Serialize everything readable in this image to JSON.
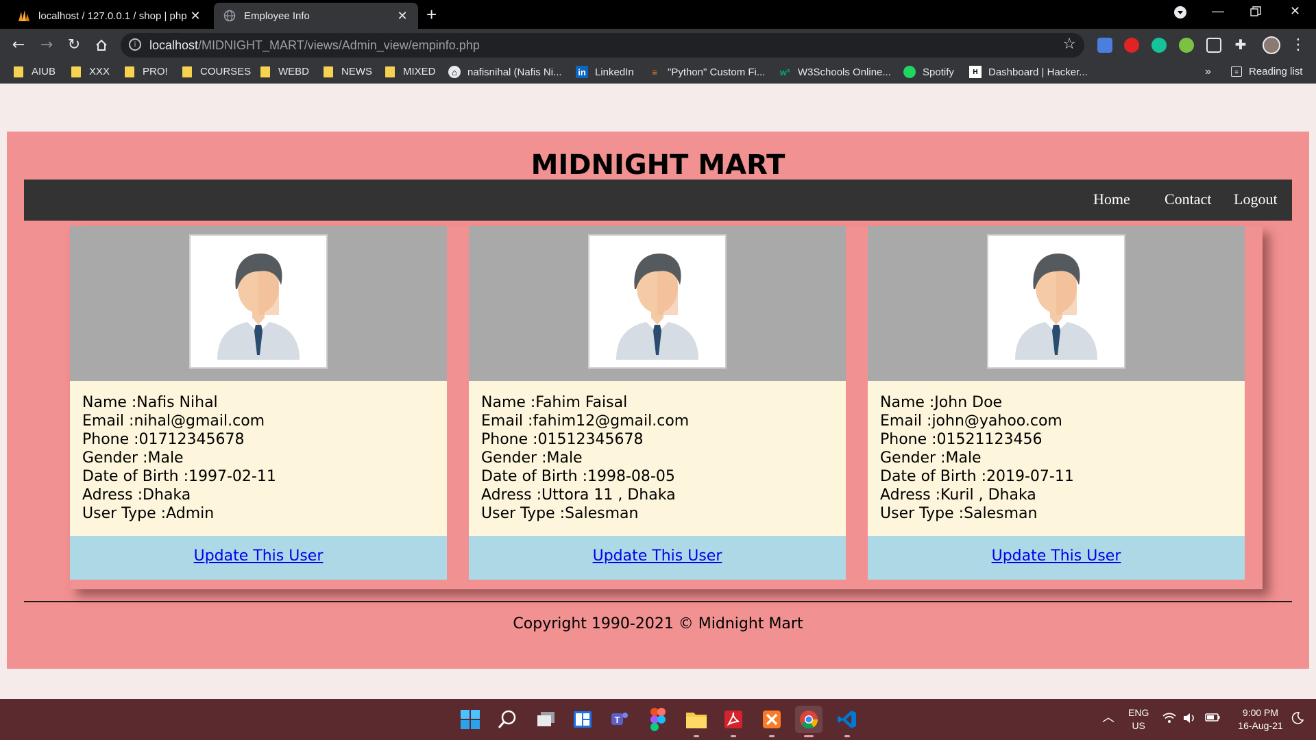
{
  "browser": {
    "tabs": [
      {
        "title": "localhost / 127.0.0.1 / shop | php",
        "icon": "phpmyadmin-icon",
        "active": false
      },
      {
        "title": "Employee Info",
        "icon": "globe-icon",
        "active": true
      }
    ],
    "address_bar": {
      "host": "localhost",
      "path": "/MIDNIGHT_MART/views/Admin_view/empinfo.php"
    },
    "bookmarks": [
      {
        "label": "AIUB",
        "icon": "folder-icon"
      },
      {
        "label": "XXX",
        "icon": "folder-icon"
      },
      {
        "label": "PRO!",
        "icon": "folder-icon"
      },
      {
        "label": "COURSES",
        "icon": "folder-icon"
      },
      {
        "label": "WEBD",
        "icon": "folder-icon"
      },
      {
        "label": "NEWS",
        "icon": "folder-icon"
      },
      {
        "label": "MIXED",
        "icon": "folder-icon"
      },
      {
        "label": "nafisnihal (Nafis Ni...",
        "icon": "github-icon"
      },
      {
        "label": "LinkedIn",
        "icon": "linkedin-icon"
      },
      {
        "label": "\"Python\" Custom Fi...",
        "icon": "stackoverflow-icon"
      },
      {
        "label": "W3Schools Online...",
        "icon": "w3schools-icon"
      },
      {
        "label": "Spotify",
        "icon": "spotify-icon"
      },
      {
        "label": "Dashboard | Hacker...",
        "icon": "hackerrank-icon"
      }
    ],
    "overflow_label": "»",
    "reading_list": "Reading list"
  },
  "site": {
    "title": "MIDNIGHT MART",
    "nav": [
      "Home",
      "Contact",
      "Logout"
    ],
    "employees": [
      {
        "name": "Name :Nafis Nihal",
        "email": "Email :nihal@gmail.com",
        "phone": "Phone :01712345678",
        "gender": "Gender :Male",
        "dob": "Date of Birth :1997-02-11",
        "address": "Adress :Dhaka",
        "user_type": "User Type :Admin",
        "action": "Update This User"
      },
      {
        "name": "Name :Fahim Faisal",
        "email": "Email :fahim12@gmail.com",
        "phone": "Phone :01512345678",
        "gender": "Gender :Male",
        "dob": "Date of Birth :1998-08-05",
        "address": "Adress :Uttora 11 , Dhaka",
        "user_type": "User Type :Salesman",
        "action": "Update This User"
      },
      {
        "name": "Name :John Doe",
        "email": "Email :john@yahoo.com",
        "phone": "Phone :01521123456",
        "gender": "Gender :Male",
        "dob": "Date of Birth :2019-07-11",
        "address": "Adress :Kuril , Dhaka",
        "user_type": "User Type :Salesman",
        "action": "Update This User"
      }
    ],
    "copyright": "Copyright 1990-2021 © Midnight Mart"
  },
  "taskbar": {
    "apps": [
      "windows-start-icon",
      "search-icon",
      "task-view-icon",
      "widgets-icon",
      "teams-icon",
      "figma-icon",
      "file-explorer-icon",
      "acrobat-icon",
      "xampp-icon",
      "chrome-icon",
      "vscode-icon"
    ],
    "language": {
      "line1": "ENG",
      "line2": "US"
    },
    "time": "9:00 PM",
    "date": "16-Aug-21"
  },
  "colors": {
    "page_bg": "#f29191",
    "navbar_bg": "#333333",
    "photo_bg": "#a9a9a9",
    "info_bg": "#fef6dc",
    "action_bg": "#add8e6",
    "taskbar_bg": "#5b2a2e"
  }
}
